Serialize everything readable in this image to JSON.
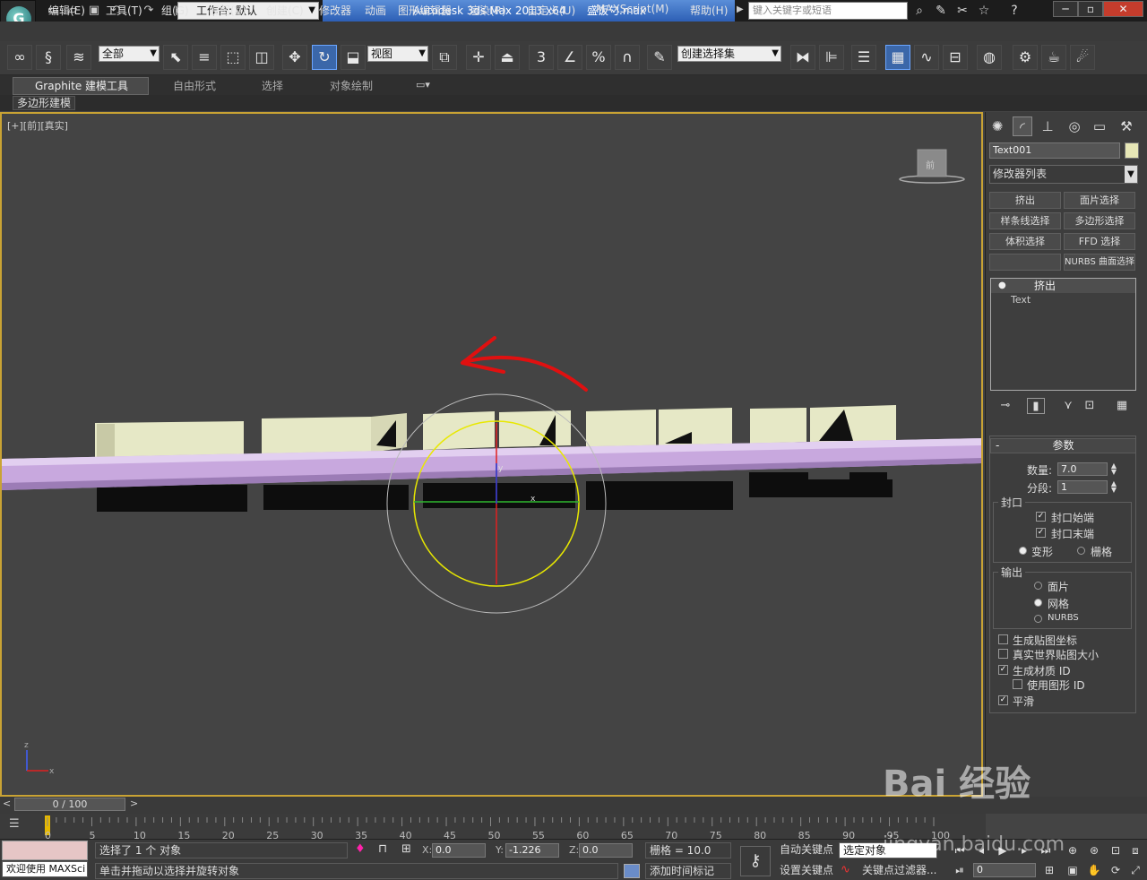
{
  "title_bar": {
    "workspace": "工作台: 默认",
    "app_title": "Autodesk 3ds Max  2013 x64",
    "file_name": "盛饭勺.max",
    "search_placeholder": "键入关键字或短语"
  },
  "menu": [
    "编辑(E)",
    "工具(T)",
    "组(G)",
    "视图(V)",
    "创建(C)",
    "修改器",
    "动画",
    "图形编辑器",
    "渲染(R)",
    "自定义(U)",
    "MAXScript(M)",
    "帮助(H)"
  ],
  "toolbar": {
    "selection_filter": "全部",
    "ref_coord": "视图",
    "named_selection": "创建选择集",
    "snap_label": "3",
    "percent_label": "%"
  },
  "ribbon": {
    "tabs": [
      "Graphite 建模工具",
      "自由形式",
      "选择",
      "对象绘制"
    ],
    "sub": "多边形建模"
  },
  "viewport": {
    "label": "[+][前][真实]",
    "viewcube": "前",
    "gizmo_x": "x",
    "gizmo_y": "y",
    "axis_z": "z",
    "axis_x": "x"
  },
  "panel": {
    "object_name": "Text001",
    "object_color": "#e6e6b6",
    "modifier_list": "修改器列表",
    "modifier_buttons": [
      "挤出",
      "面片选择",
      "样条线选择",
      "多边形选择",
      "体积选择",
      "FFD 选择",
      "",
      "NURBS 曲面选择"
    ],
    "stack": [
      "挤出",
      "Text"
    ],
    "params_title": "参数",
    "amount_label": "数量:",
    "amount": "7.0",
    "segments_label": "分段:",
    "segments": "1",
    "capping_title": "封口",
    "cap_start": "封口始端",
    "cap_end": "封口末端",
    "morph": "变形",
    "grid": "栅格",
    "output_title": "输出",
    "patch": "面片",
    "mesh": "网格",
    "nurbs": "NURBS",
    "gen_map": "生成贴图坐标",
    "real_world": "真实世界贴图大小",
    "gen_mat": "生成材质 ID",
    "use_shape_ids": "使用图形 ID",
    "smooth": "平滑"
  },
  "timeline": {
    "slider": "0 / 100",
    "ticks": [
      "0",
      "5",
      "10",
      "15",
      "20",
      "25",
      "30",
      "35",
      "40",
      "45",
      "50",
      "55",
      "60",
      "65",
      "70",
      "75",
      "80",
      "85",
      "90",
      "95",
      "100"
    ]
  },
  "status": {
    "welcome": "欢迎使用 MAXSci",
    "selection": "选择了 1 个 对象",
    "prompt": "单击并拖动以选择并旋转对象",
    "x_label": "X:",
    "x": "0.0",
    "y_label": "Y:",
    "y": "-1.226",
    "z_label": "Z:",
    "z": "0.0",
    "grid": "栅格 = 10.0",
    "add_time_tag": "添加时间标记",
    "auto_key": "自动关键点",
    "set_key": "设置关键点",
    "selected_obj": "选定对象",
    "key_filters": "关键点过滤器...",
    "frame": "0"
  },
  "watermark": {
    "brand": "Bai 经验",
    "url": "jingyan.baidu.com"
  }
}
